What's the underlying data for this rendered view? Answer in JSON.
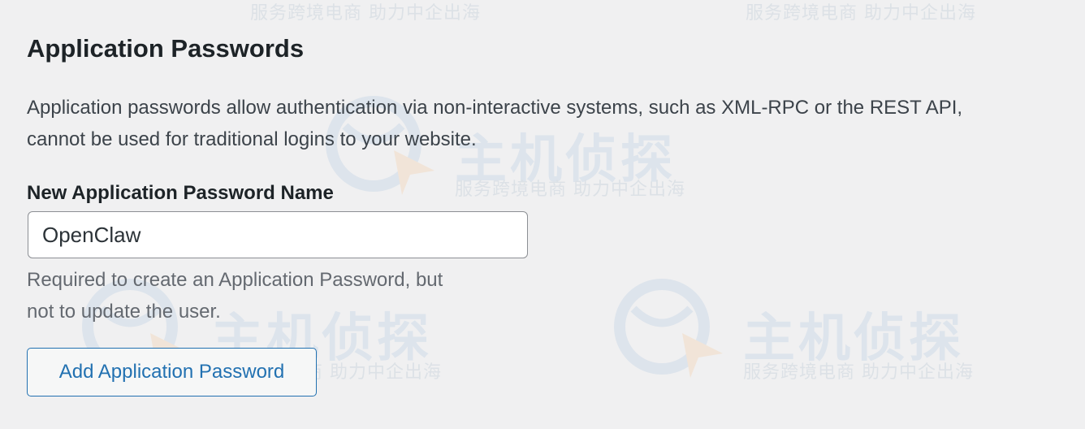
{
  "section": {
    "heading": "Application Passwords",
    "description_line1": "Application passwords allow authentication via non-interactive systems, such as XML-RPC or the REST API,",
    "description_line2": "cannot be used for traditional logins to your website."
  },
  "form": {
    "name_label": "New Application Password Name",
    "name_value": "OpenClaw",
    "help_line1": "Required to create an Application Password, but",
    "help_line2": "not to update the user.",
    "add_button_label": "Add Application Password"
  },
  "watermark": {
    "main_text": "主机侦探",
    "sub_text": "服务跨境电商 助力中企出海"
  },
  "colors": {
    "background": "#f0f0f1",
    "accent": "#2271b1",
    "heading": "#1d2327",
    "muted": "#646970"
  }
}
